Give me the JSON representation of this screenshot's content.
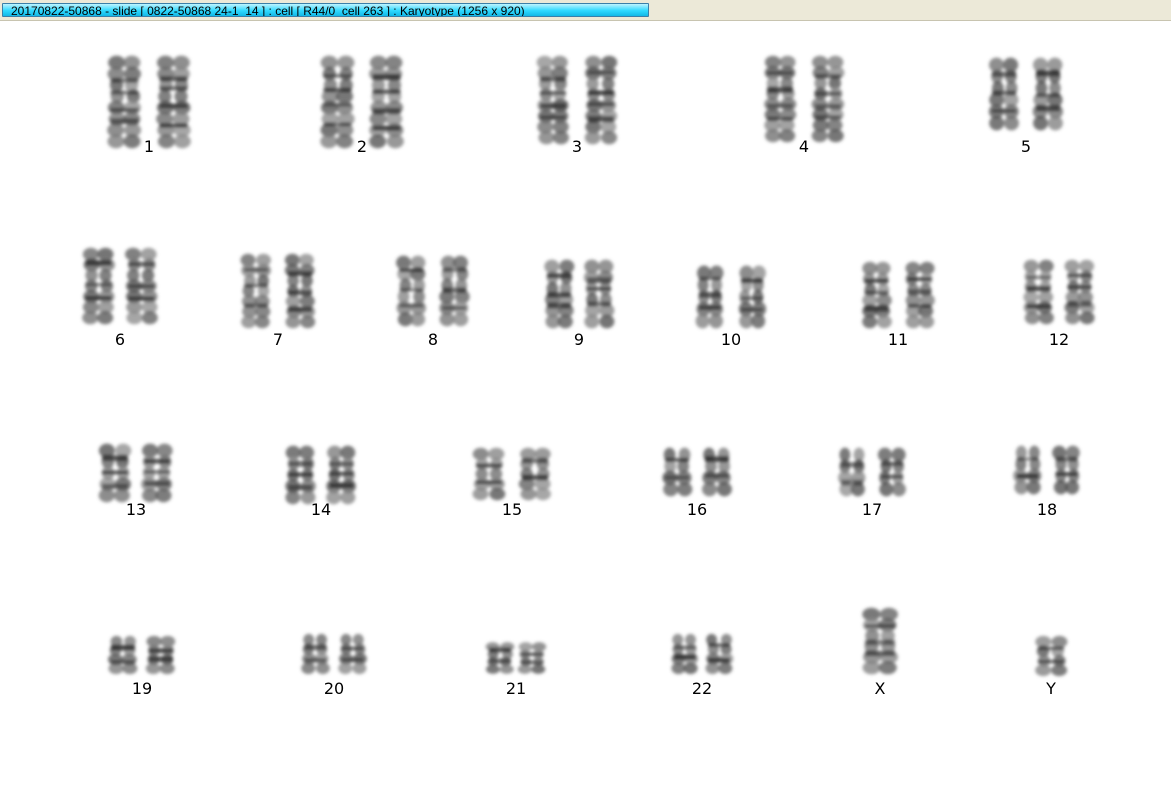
{
  "window": {
    "title": "20170822-50868 - slide [ 0822-50868 24-1_14 ] : cell [ R44/0_cell 263 ] : Karyotype  (1256 x 920)"
  },
  "karyotype": {
    "chromosomes": [
      "1",
      "2",
      "3",
      "4",
      "5",
      "6",
      "7",
      "8",
      "9",
      "10",
      "11",
      "12",
      "13",
      "14",
      "15",
      "16",
      "17",
      "18",
      "19",
      "20",
      "21",
      "22",
      "X",
      "Y"
    ],
    "copies": {
      "1": 2,
      "2": 2,
      "3": 2,
      "4": 2,
      "5": 2,
      "6": 2,
      "7": 2,
      "8": 2,
      "9": 2,
      "10": 2,
      "11": 2,
      "12": 2,
      "13": 2,
      "14": 2,
      "15": 2,
      "16": 2,
      "17": 2,
      "18": 2,
      "19": 2,
      "20": 2,
      "21": 2,
      "22": 2,
      "X": 1,
      "Y": 1
    }
  }
}
